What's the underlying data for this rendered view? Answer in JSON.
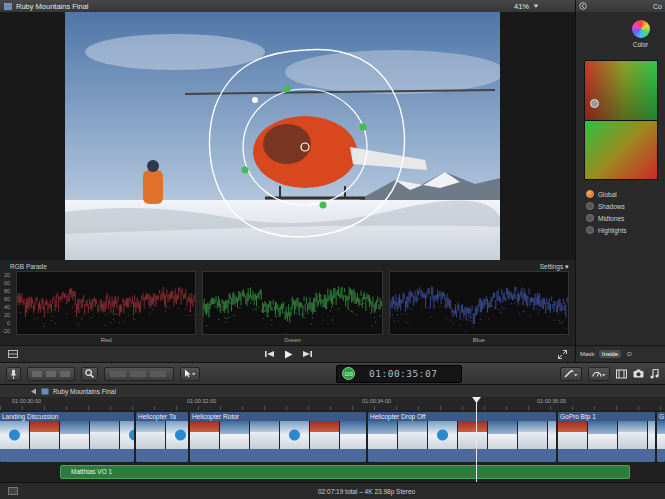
{
  "window": {
    "title": "Ruby Mountains Final",
    "zoom": "41%"
  },
  "inspector": {
    "header": "Co",
    "title": "Color",
    "ranges": [
      {
        "label": "Global",
        "selected": true
      },
      {
        "label": "Shadows",
        "selected": false
      },
      {
        "label": "Midtones",
        "selected": false
      },
      {
        "label": "Highlights",
        "selected": false
      }
    ],
    "mask": {
      "label": "Mask:",
      "options": [
        {
          "label": "Inside",
          "selected": true
        },
        {
          "label": "O",
          "selected": false
        }
      ]
    }
  },
  "scopes": {
    "title": "RGB Parade",
    "settings": "Settings ▾",
    "scale": [
      "20",
      "00",
      "80",
      "60",
      "40",
      "20",
      "0",
      "-20"
    ],
    "channels": [
      {
        "label": "Red",
        "color": "#e8474f"
      },
      {
        "label": "Green",
        "color": "#4fd860"
      },
      {
        "label": "Blue",
        "color": "#5a78f0"
      }
    ]
  },
  "toolbar": {
    "badge": "100",
    "timecode": "01:00:35:07"
  },
  "timeline": {
    "title": "Ruby Mountains Final",
    "ruler": [
      "01:00:30:00",
      "01:00:32:00",
      "01:00:34:00",
      "01:00:36:00"
    ],
    "clips": [
      {
        "label": "Landing Discussion"
      },
      {
        "label": "Helicopter Ta"
      },
      {
        "label": "Helicopter Rotor"
      },
      {
        "label": "Helicopter Drop Off"
      },
      {
        "label": "GoPro Btp 1"
      },
      {
        "label": "G"
      }
    ],
    "audio": {
      "label": "Matthias VO 1"
    }
  },
  "status_bar": "02:07:19 total – 4K 23.98p Stereo"
}
